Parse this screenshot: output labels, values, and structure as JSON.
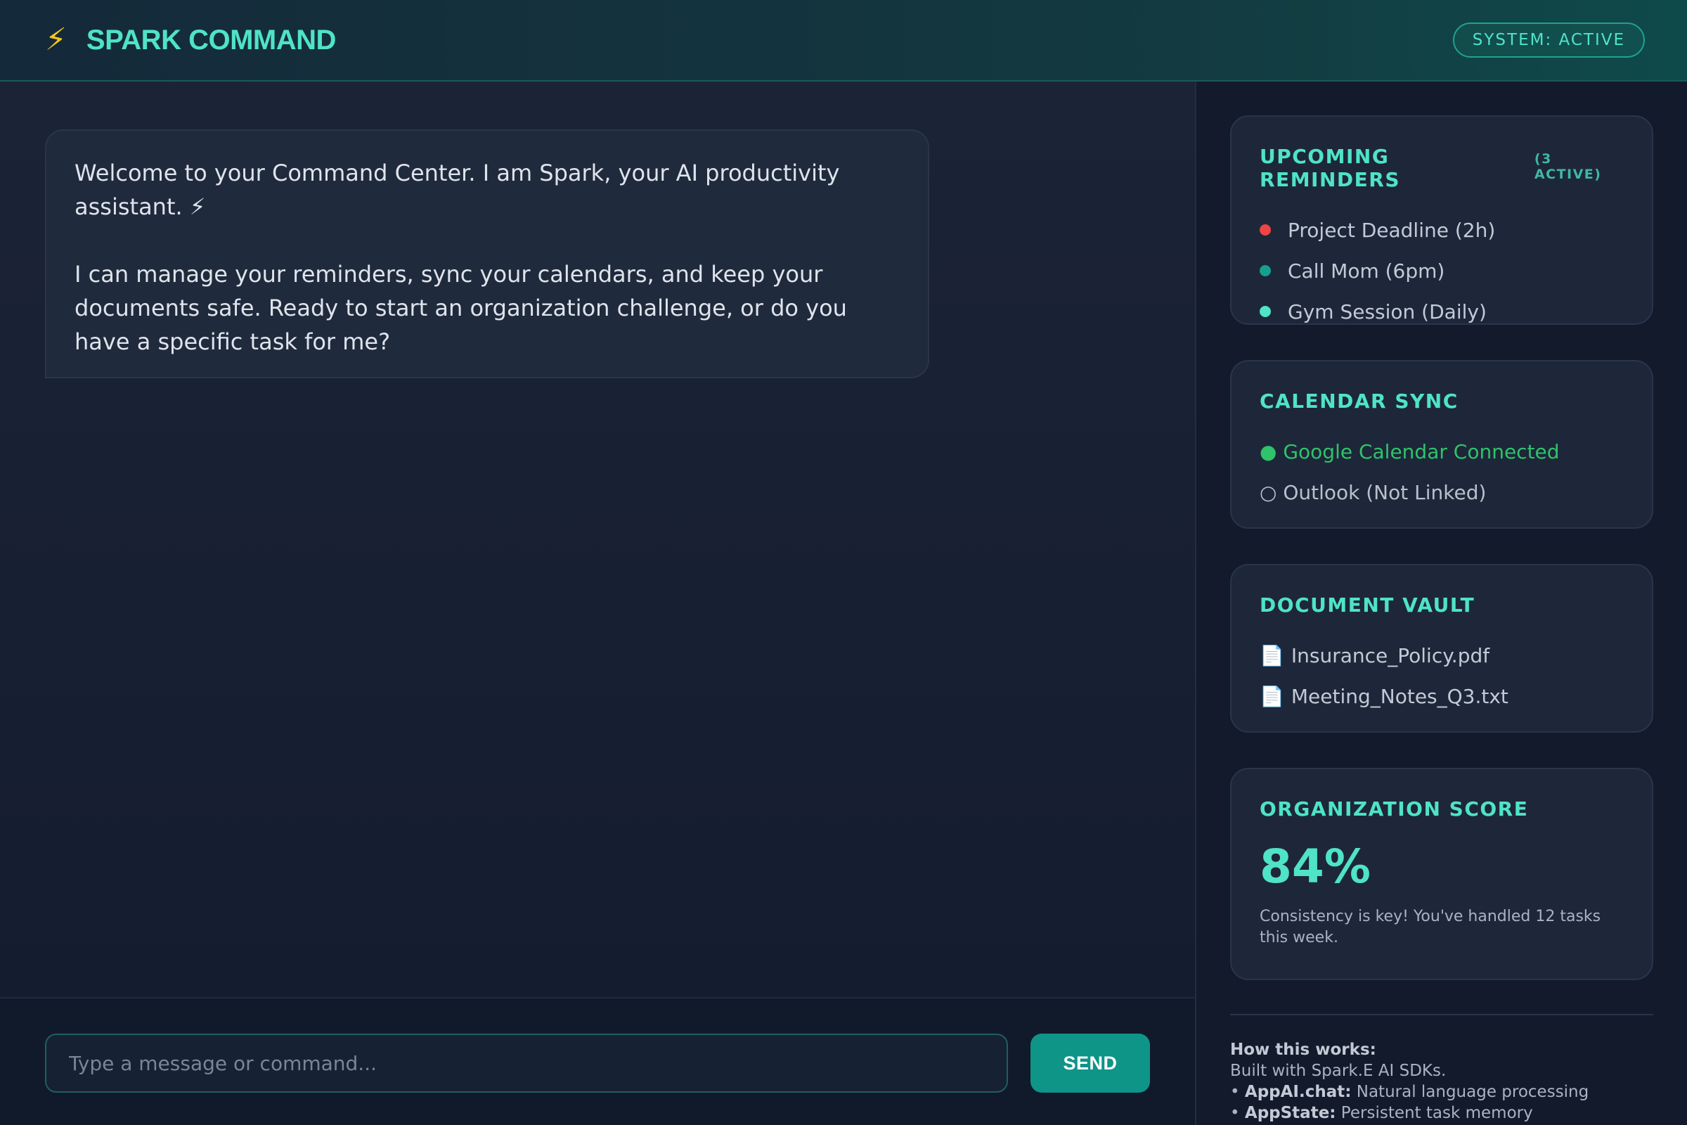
{
  "header": {
    "title": "SPARK COMMAND",
    "status": "SYSTEM: ACTIVE"
  },
  "chat": {
    "message_p1": "Welcome to your Command Center. I am Spark, your AI productivity assistant. ⚡",
    "message_p2": "I can manage your reminders, sync your calendars, and keep your documents safe. Ready to start an organization challenge, or do you have a specific task for me?",
    "input_placeholder": "Type a message or command...",
    "send_label": "SEND"
  },
  "reminders": {
    "title": "UPCOMING REMINDERS",
    "count_label": "(3 ACTIVE)",
    "items": [
      {
        "label": "Project Deadline (2h)",
        "color": "#ef4444"
      },
      {
        "label": "Call Mom (6pm)",
        "color": "#14a08e"
      },
      {
        "label": "Gym Session (Daily)",
        "color": "#4fe3c7"
      }
    ]
  },
  "calendar": {
    "title": "CALENDAR SYNC",
    "connected": "● Google Calendar Connected",
    "not_linked": "○ Outlook (Not Linked)"
  },
  "documents": {
    "title": "DOCUMENT VAULT",
    "files": [
      "Insurance_Policy.pdf",
      "Meeting_Notes_Q3.txt"
    ],
    "icon": "document-icon"
  },
  "score": {
    "title": "ORGANIZATION SCORE",
    "value": "84%",
    "note": "Consistency is key! You've handled 12 tasks this week."
  },
  "how": {
    "heading": "How this works:",
    "line1": "Built with Spark.E AI SDKs.",
    "item1_key": "AppAI.chat:",
    "item1_val": " Natural language processing",
    "item2_key": "AppState:",
    "item2_val": " Persistent task memory"
  },
  "colors": {
    "accent": "#4fe3c7",
    "send_button": "#0f9488",
    "bolt": "#f5c518"
  }
}
